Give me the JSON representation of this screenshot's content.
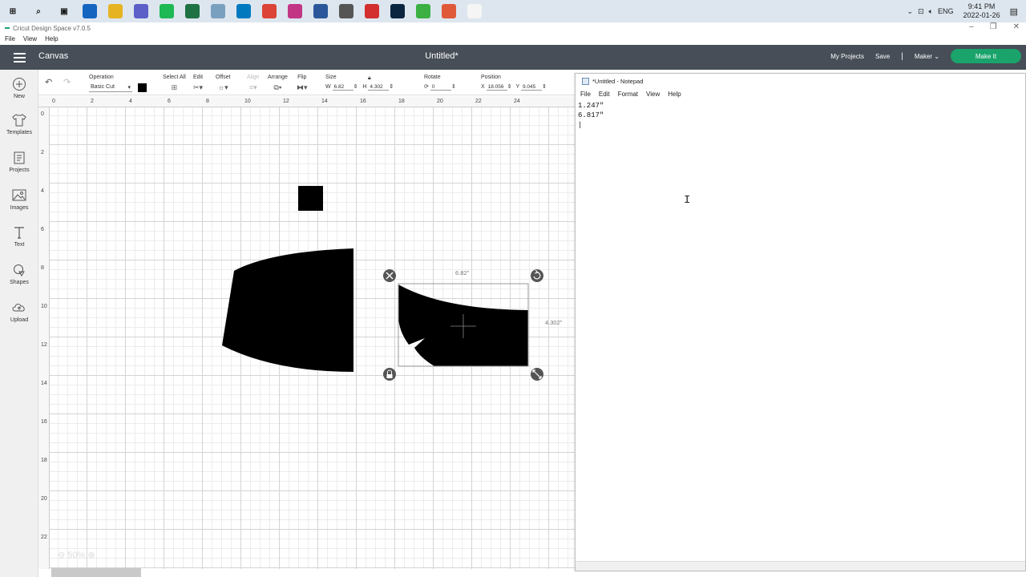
{
  "taskbar": {
    "apps": [
      {
        "name": "windows-start",
        "color": "#1a1a1a"
      },
      {
        "name": "search",
        "color": "#1a1a1a"
      },
      {
        "name": "task-view",
        "color": "#1a1a1a"
      },
      {
        "name": "outlook",
        "color": "#1565c0"
      },
      {
        "name": "file-explorer",
        "color": "#e6b422"
      },
      {
        "name": "teams",
        "color": "#5b5fc7"
      },
      {
        "name": "spotify",
        "color": "#1db954"
      },
      {
        "name": "excel",
        "color": "#1f7244"
      },
      {
        "name": "app-gray",
        "color": "#7aa0c0"
      },
      {
        "name": "trello",
        "color": "#0079bf"
      },
      {
        "name": "chrome",
        "color": "#db4437"
      },
      {
        "name": "instagram",
        "color": "#c13584"
      },
      {
        "name": "word",
        "color": "#2b579a"
      },
      {
        "name": "settings",
        "color": "#555555"
      },
      {
        "name": "acrobat",
        "color": "#d32f2f"
      },
      {
        "name": "photoshop",
        "color": "#0b2540"
      },
      {
        "name": "camtasia-green",
        "color": "#3cb043"
      },
      {
        "name": "camtasia-red",
        "color": "#e05a3a"
      },
      {
        "name": "cricut",
        "color": "#f5f5f5"
      }
    ],
    "lang": "ENG",
    "time": "9:41 PM",
    "date": "2022-01-26"
  },
  "app": {
    "title": "Cricut Design Space  v7.0.5",
    "menu": [
      "File",
      "View",
      "Help"
    ]
  },
  "header": {
    "canvas_label": "Canvas",
    "doc_title": "Untitled*",
    "my_projects": "My Projects",
    "save": "Save",
    "separator": "|",
    "machine": "Maker",
    "make_it": "Make It"
  },
  "toolbar": {
    "operation_label": "Operation",
    "operation_value": "Basic Cut",
    "select_all": "Select All",
    "edit": "Edit",
    "offset": "Offset",
    "align": "Align",
    "arrange": "Arrange",
    "flip": "Flip",
    "size_label": "Size",
    "w_label": "W",
    "w_value": "6.82",
    "h_label": "H",
    "h_value": "4.302",
    "rotate_label": "Rotate",
    "rotate_value": "0",
    "position_label": "Position",
    "x_label": "X",
    "x_value": "18.056",
    "y_label": "Y",
    "y_value": "9.045",
    "colors": {
      "swatch": "#000000",
      "accent": "#1aa36b",
      "header": "#474e57"
    }
  },
  "sidebar": {
    "items": [
      {
        "label": "New"
      },
      {
        "label": "Templates"
      },
      {
        "label": "Projects"
      },
      {
        "label": "Images"
      },
      {
        "label": "Text"
      },
      {
        "label": "Shapes"
      },
      {
        "label": "Upload"
      }
    ]
  },
  "rulers": {
    "top": [
      "0",
      "2",
      "4",
      "6",
      "8",
      "10",
      "12",
      "14",
      "16",
      "18",
      "20",
      "22",
      "24"
    ],
    "left": [
      "0",
      "2",
      "4",
      "6",
      "8",
      "10",
      "12",
      "14",
      "16",
      "18",
      "20",
      "22"
    ]
  },
  "selection": {
    "width_label": "6.82\"",
    "height_label": "4.302\""
  },
  "zoom": "50%",
  "notepad": {
    "title": "*Untitled - Notepad",
    "menu": [
      "File",
      "Edit",
      "Format",
      "View",
      "Help"
    ],
    "text": "1.247\"\n6.817\"\n|"
  }
}
